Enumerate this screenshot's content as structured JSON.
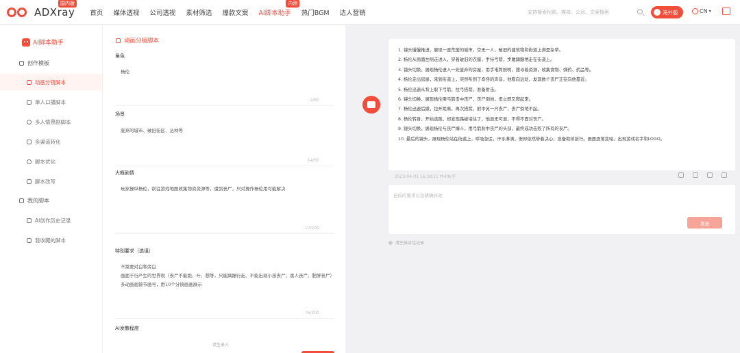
{
  "brand": {
    "name": "ADXray",
    "badge": "国内版"
  },
  "nav": {
    "items": [
      "首页",
      "媒体透视",
      "公司透视",
      "素材筛选",
      "爆款文案",
      "AI脚本助手",
      "热门BGM",
      "达人营销"
    ],
    "active_index": 5,
    "ai_badge": "内测"
  },
  "header": {
    "search_placeholder": "支持搜索标题、媒体、公司、文案搜索",
    "share_label": "海外版",
    "lang_label": "CN"
  },
  "sidebar": {
    "title": "AI脚本助手",
    "group_templates": "创作模板",
    "items": [
      "动画分镜脚本",
      "单人口播脚本",
      "多人情景剧脚本",
      "多渠道转化",
      "脚本优化",
      "脚本改写"
    ],
    "group_mine": "我的脚本",
    "mine_items": [
      "AI创作历史记录",
      "我收藏的脚本"
    ]
  },
  "form": {
    "title": "动画分镜脚本",
    "fields": [
      {
        "label": "角色",
        "value": [
          "杨伦"
        ],
        "counter": "2/50"
      },
      {
        "label": "场景",
        "value": [
          "废弃的城市、破旧街区、丛林等"
        ],
        "counter": "14/50"
      },
      {
        "label": "大概剧情",
        "value": [
          "玩家操纵杨伦，前往游戏地图收集物资资源等，遭到丧尸，只对操作杨伦用可能解决"
        ],
        "counter": "17/200"
      },
      {
        "label": "特别要求（选填）",
        "value": [
          "不需要对白和旁白",
          "画面于行产生的世界观（丧尸不能跑、叶、想等，只能蹒跚行走、不能出现小孩丧尸、黑人丧尸、肥胖丧尸）",
          "多动画画镜节画号，用10个分镜画画展示"
        ],
        "counter": "76/200"
      },
      {
        "label": "AI发散程度",
        "value": [],
        "counter": ""
      }
    ],
    "upload_hint": "请生录入"
  },
  "chat": {
    "script_lines": [
      "1. 镜头慢慢推进，展现一座荒废的城市，空无一人，破旧的建筑物和街道上满是杂草。",
      "2. 杨伦从画面左侧走进入，穿着破旧的衣服，手持弓箭，步履蹒跚地走在街道上。",
      "3. 镜头切换，展现杨伦进入一处废弃的房屋，用手电筒照明，搜寻着资源，收集食物、弹药、药品等。",
      "4. 杨伦走出房屋，来到街道上，突然听到了奇怪的声音，他看向远处，发现数个丧尸正在向他靠近。",
      "5. 杨伦迅速从背上取下弓箭，拉弓搭箭，准备射击。",
      "6. 镜头切换，展现杨伦用弓箭击中丧尸，丧尸倒地，但立即又爬起来。",
      "7. 杨伦迅速后撤，拉开距离，再次搭箭，射中另一只丧尸，丧尸倒地不起。",
      "8. 杨伦转身，开始逃跑，却发现路被堵住了，他退无可退，不得不面对丧尸。",
      "9. 镜头切换，展现杨伦与丧尸搏斗，用弓箭刺中丧尸的头部，最终成功击败了所有的丧尸。",
      "10. 最后的镜头，展现杨伦站在街道上，呼吸急促，汗水淋漓，但却依然带着决心，准备继续前行。画面逐渐变暗，出现游戏名字和LOGO。"
    ],
    "meta": "2023-04-03 16:38:11    共406字",
    "input_placeholder": "自拟的要求以及精确修改",
    "send_label": "发送",
    "clear_label": "清空该对话记录"
  }
}
